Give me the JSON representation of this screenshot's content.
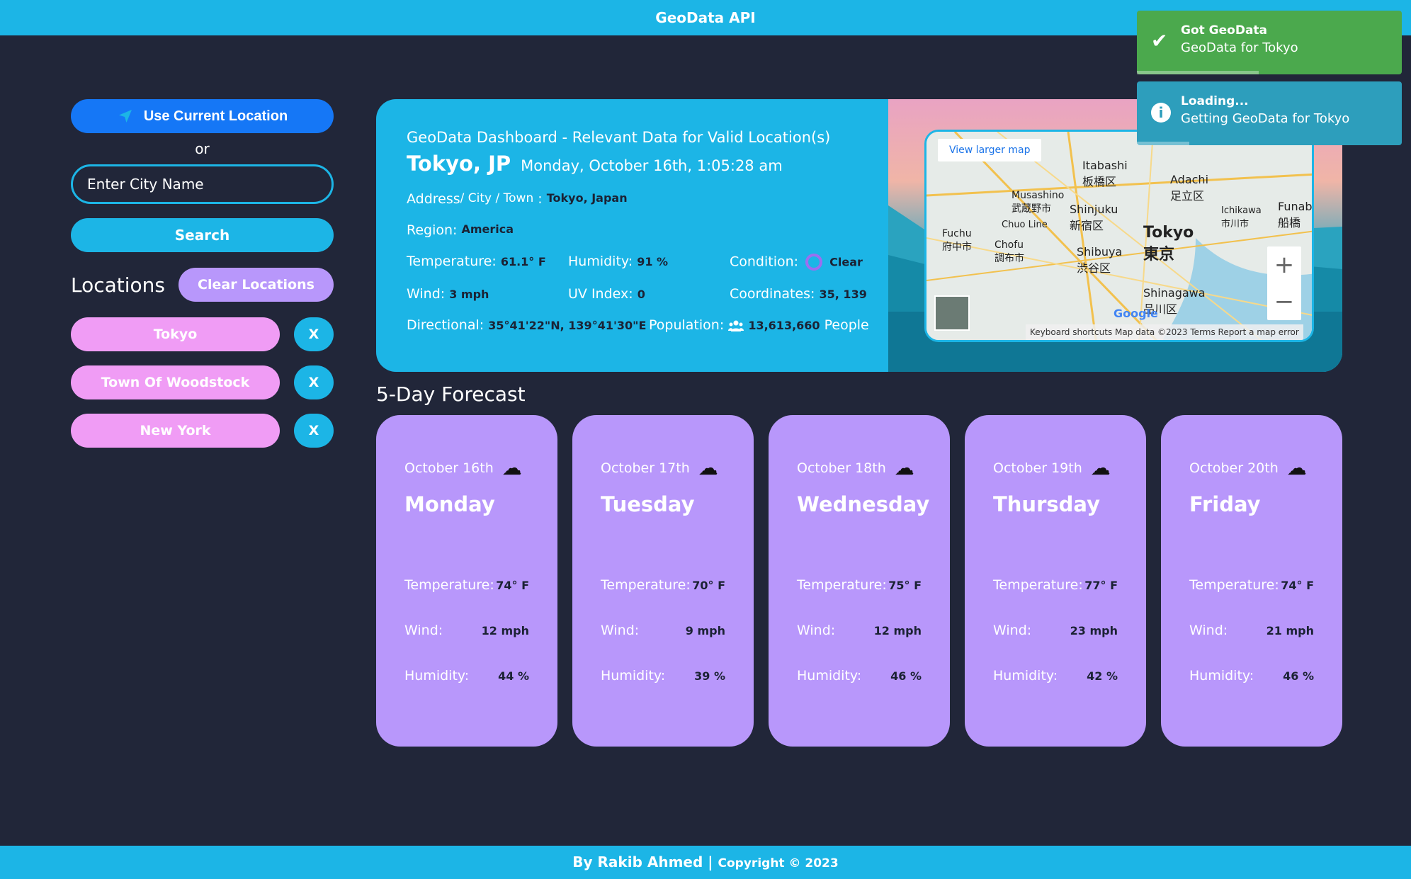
{
  "header": {
    "title": "GeoData API"
  },
  "sidebar": {
    "use_location_label": "Use Current Location",
    "or_label": "or",
    "city_placeholder": "Enter City Name",
    "search_label": "Search",
    "locations_title": "Locations",
    "clear_label": "Clear Locations",
    "locations": [
      {
        "name": "Tokyo",
        "remove": "X"
      },
      {
        "name": "Town Of Woodstock",
        "remove": "X"
      },
      {
        "name": "New York",
        "remove": "X"
      }
    ]
  },
  "dashboard": {
    "subtitle": "GeoData Dashboard - Relevant Data for Valid Location(s)",
    "city": "Tokyo, JP",
    "datetime": "Monday, October 16th, 1:05:28 am",
    "address_label": "Address",
    "address_sub": " / City / Town",
    "address_value": "Tokyo, Japan",
    "region_label": "Region:",
    "region_value": "America",
    "temperature_label": "Temperature:",
    "temperature_value": "61.1° F",
    "humidity_label": "Humidity:",
    "humidity_value": "91 %",
    "condition_label": "Condition:",
    "condition_value": "Clear",
    "wind_label": "Wind:",
    "wind_value": "3 mph",
    "uv_label": "UV Index:",
    "uv_value": "0",
    "coords_label": "Coordinates:",
    "coords_value": "35, 139",
    "directional_label": "Directional:",
    "directional_value": "35°41'22\"N, 139°41'30\"E",
    "population_label": "Population:",
    "population_value": "13,613,660",
    "population_unit": "People"
  },
  "map": {
    "view_larger": "View larger map",
    "zoom_in": "+",
    "zoom_out": "−",
    "google": "Google",
    "attribution": "Keyboard shortcuts   Map data ©2023   Terms   Report a map error",
    "labels": {
      "itabashi": "Itabashi",
      "itabashi_jp": "板橋区",
      "adachi": "Adachi",
      "adachi_jp": "足立区",
      "shinjuku": "Shinjuku",
      "shinjuku_jp": "新宿区",
      "tokyo": "Tokyo",
      "tokyo_jp": "東京",
      "shibuya": "Shibuya",
      "shibuya_jp": "渋谷区",
      "shinagawa": "Shinagawa",
      "shinagawa_jp": "品川区",
      "musashino": "Musashino",
      "musashino_jp": "武蔵野市",
      "fuchu": "Fuchu",
      "fuchu_jp": "府中市",
      "chofu": "Chofu",
      "chofu_jp": "調布市",
      "ichikawa": "Ichikawa",
      "ichikawa_jp": "市川市",
      "funab": "Funab",
      "funab_jp": "船橋",
      "chuo_line": "Chuo Line"
    }
  },
  "toasts": [
    {
      "title": "Got GeoData",
      "message": "GeoData for Tokyo",
      "icon": "check-icon"
    },
    {
      "title": "Loading...",
      "message": "Getting GeoData for Tokyo",
      "icon": "info-icon"
    }
  ],
  "forecast": {
    "title": "5-Day Forecast",
    "temperature_label": "Temperature:",
    "wind_label": "Wind:",
    "humidity_label": "Humidity:",
    "days": [
      {
        "date": "October 16th",
        "day": "Monday",
        "temp": "74° F",
        "wind": "12 mph",
        "humidity": "44 %",
        "icon": "rain-cloud-icon"
      },
      {
        "date": "October 17th",
        "day": "Tuesday",
        "temp": "70° F",
        "wind": "9 mph",
        "humidity": "39 %",
        "icon": "cloud-icon"
      },
      {
        "date": "October 18th",
        "day": "Wednesday",
        "temp": "75° F",
        "wind": "12 mph",
        "humidity": "46 %",
        "icon": "cloud-icon"
      },
      {
        "date": "October 19th",
        "day": "Thursday",
        "temp": "77° F",
        "wind": "23 mph",
        "humidity": "42 %",
        "icon": "cloud-icon"
      },
      {
        "date": "October 20th",
        "day": "Friday",
        "temp": "74° F",
        "wind": "21 mph",
        "humidity": "46 %",
        "icon": "cloud-icon"
      }
    ]
  },
  "footer": {
    "author": "By Rakib Ahmed |",
    "copyright": "Copyright © 2023"
  },
  "colors": {
    "accent": "#1cb5e6",
    "background": "#212639",
    "card": "#b897fb",
    "location_pill": "#f09cf5",
    "primary_button": "#1577f6"
  }
}
